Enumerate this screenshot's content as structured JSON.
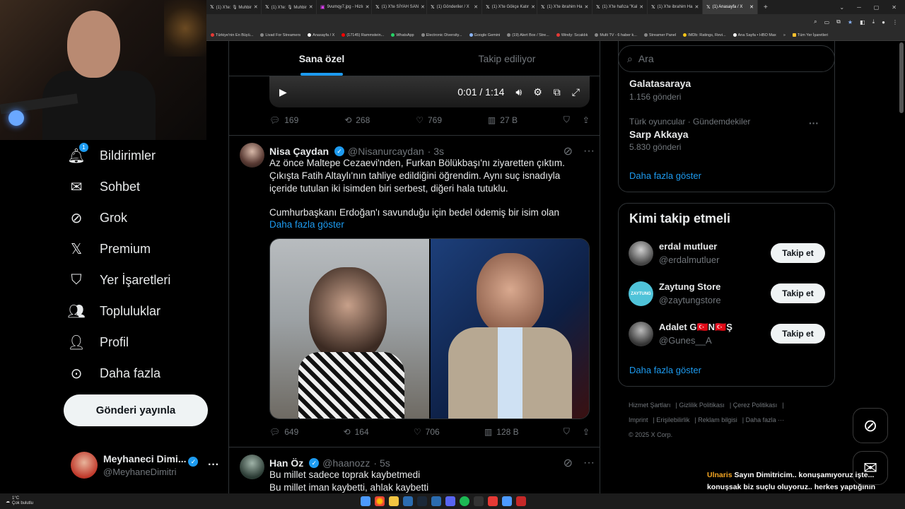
{
  "browser": {
    "tabs": [
      {
        "label": "(1) X'te: 🎙 Muhbir"
      },
      {
        "label": "(1) X'te: 🎙 Muhbir"
      },
      {
        "label": "9vumqy7.jpg - Hizlı"
      },
      {
        "label": "(1) X'te SİYAH SAN"
      },
      {
        "label": "(1) Gönderiler / X"
      },
      {
        "label": "(1) X'te Gökçe Katır"
      },
      {
        "label": "(1) X'te ibrahim Ha"
      },
      {
        "label": "(1) X'te hafıza \"Kal"
      },
      {
        "label": "(1) X'te ibrahim Ha"
      },
      {
        "label": "(1) Anasayfa / X"
      }
    ],
    "new_tab": "+",
    "bookmarks": [
      "Türkiye'nin En Büyü...",
      "Livad For Streamers",
      "Anasayfa / X",
      "(17145) Rammstein...",
      "WhatsApp",
      "Electronic Diversity...",
      "Google Gemini",
      "(19) Alert Box / Stre...",
      "Windy: Sıcaklık",
      "Multi TV - 6 haber k...",
      "Streamer Panel",
      "IMDb: Ratings, Revi...",
      "Ana Sayfa • HBO Max",
      "»",
      "Tüm Yer İşaretleri"
    ]
  },
  "sidebar": {
    "items": [
      {
        "label": "Bildirimler",
        "icon": "bell-icon",
        "badge": "1"
      },
      {
        "label": "Sohbet",
        "icon": "mail-icon"
      },
      {
        "label": "Grok",
        "icon": "grok-icon"
      },
      {
        "label": "Premium",
        "icon": "x-logo-icon"
      },
      {
        "label": "Yer İşaretleri",
        "icon": "bookmark-icon"
      },
      {
        "label": "Topluluklar",
        "icon": "people-icon"
      },
      {
        "label": "Profil",
        "icon": "person-icon"
      },
      {
        "label": "Daha fazla",
        "icon": "more-circle-icon"
      }
    ],
    "post_button": "Gönderi yayınla",
    "account": {
      "name": "Meyhaneci Dimi...",
      "handle": "@MeyhaneDimitri",
      "more": "···"
    }
  },
  "feed": {
    "tabs": [
      "Sana özel",
      "Takip ediliyor"
    ],
    "video": {
      "time": "0:01 / 1:14"
    },
    "tweet0_actions": {
      "replies": "169",
      "reposts": "268",
      "likes": "769",
      "views": "27 B"
    },
    "tweet1": {
      "name": "Nisa Çaydan",
      "handle": "@Nisanurcaydan",
      "time": "· 3s",
      "text1": "Az önce Maltepe Cezaevi'nden, Furkan Bölükbaşı'nı ziyaretten çıktım. Çıkışta Fatih Altaylı'nın tahliye edildiğini öğrendim. Aynı suç isnadıyla içeride tutulan iki isimden biri serbest, diğeri hala tutuklu.",
      "text2": "Cumhurbaşkanı Erdoğan'ı savunduğu için bedel ödemiş bir isim olan",
      "more": "Daha fazla göster",
      "actions": {
        "replies": "649",
        "reposts": "164",
        "likes": "706",
        "views": "128 B"
      }
    },
    "tweet2": {
      "name": "Han Öz",
      "handle": "@haanozz",
      "time": "· 5s",
      "line1": "Bu millet sadece toprak kaybetmedi",
      "line2": "Bu millet iman kaybetti, ahlak kaybetti"
    }
  },
  "right": {
    "search_placeholder": "Ara",
    "trends": [
      {
        "title": "Galatasaraya",
        "count": "1.156 gönderi"
      },
      {
        "category": "Türk oyuncular · Gündemdekiler",
        "title": "Sarp Akkaya",
        "count": "5.830 gönderi"
      }
    ],
    "trends_more": "Daha fazla göster",
    "who_to_follow": {
      "title": "Kimi takip etmeli",
      "users": [
        {
          "name": "erdal mutluer",
          "handle": "@erdalmutluer",
          "button": "Takip et"
        },
        {
          "name": "Zaytung Store",
          "handle": "@zaytungstore",
          "button": "Takip et"
        },
        {
          "name": "Adalet G🇹🇷N🇹🇷Ş",
          "handle": "@Gunes__A",
          "button": "Takip et"
        }
      ],
      "more": "Daha fazla göster"
    },
    "footer": [
      "Hizmet Şartları",
      "Gizlilik Politikası",
      "Çerez Politikası",
      "Imprint",
      "Erişilebilirlik",
      "Reklam bilgisi",
      "Daha fazla ···",
      "© 2025 X Corp."
    ]
  },
  "overlay": {
    "chat_user": "Ulnaris",
    "chat_text": "Sayın Dimitricim.. konuşamıyoruz işte... konuşsak biz suçlu oluyoruz.. herkes yaptığının bedelini birgün öder umarım diyorum sadece",
    "weather_temp": "1°C",
    "weather_desc": "Çok bulutlu"
  },
  "colors": {
    "accent": "#1d9bf0",
    "background": "#000000",
    "border": "#2f3336",
    "muted": "#71767b",
    "chat_user": "#f5a623"
  }
}
